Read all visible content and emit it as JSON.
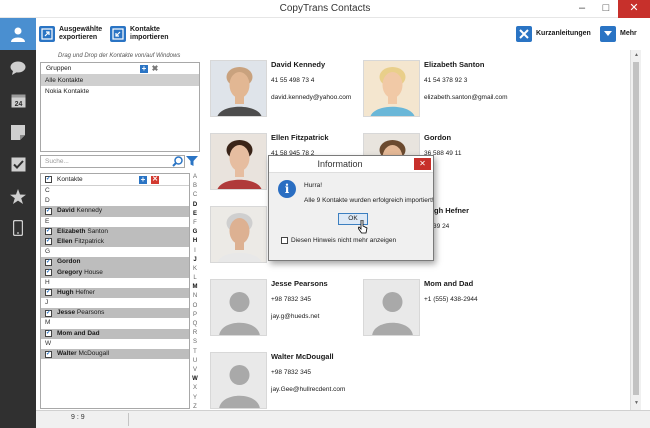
{
  "window": {
    "title": "CopyTrans Contacts"
  },
  "toolbar": {
    "export_label_1": "Ausgewählte",
    "export_label_2": "exportieren",
    "import_label_1": "Kontakte",
    "import_label_2": "importieren",
    "guides_label": "Kurzanleitungen",
    "more_label": "Mehr"
  },
  "hint": "Drag und Drop der Kontakte von/auf Windows",
  "groups": {
    "header": "Gruppen",
    "items": [
      "Alle Kontakte",
      "Nokia Kontakte"
    ]
  },
  "search": {
    "placeholder": "Suche..."
  },
  "contacts_list": {
    "header": "Kontakte",
    "rows": [
      {
        "letter": "C"
      },
      {
        "letter": "D"
      },
      {
        "first": "David",
        "last": "Kennedy"
      },
      {
        "letter": "E"
      },
      {
        "first": "Elizabeth",
        "last": "Santon"
      },
      {
        "first": "Ellen",
        "last": "Fitzpatrick"
      },
      {
        "letter": "G"
      },
      {
        "first": "Gordon",
        "last": ""
      },
      {
        "first": "Gregory",
        "last": "House"
      },
      {
        "letter": "H"
      },
      {
        "first": "Hugh",
        "last": "Hefner"
      },
      {
        "letter": "J"
      },
      {
        "first": "Jesse",
        "last": "Pearsons"
      },
      {
        "letter": "M"
      },
      {
        "first": "Mom and Dad",
        "last": ""
      },
      {
        "letter": "W"
      },
      {
        "first": "Walter",
        "last": "McDougall"
      }
    ]
  },
  "alphabet": [
    "A",
    "B",
    "C",
    "D",
    "E",
    "F",
    "G",
    "H",
    "I",
    "J",
    "K",
    "L",
    "M",
    "N",
    "O",
    "P",
    "Q",
    "R",
    "S",
    "T",
    "U",
    "V",
    "W",
    "X",
    "Y",
    "Z"
  ],
  "alphabet_active": [
    "D",
    "E",
    "G",
    "H",
    "J",
    "M",
    "W"
  ],
  "cards": [
    {
      "name": "David Kennedy",
      "phone": "41 55 498 73 4",
      "email": "david.kennedy@yahoo.com",
      "photo": "man-bald"
    },
    {
      "name": "Elizabeth Santon",
      "phone": "41 54 378 92 3",
      "email": "elizabeth.santon@gmail.com",
      "photo": "woman-blonde"
    },
    {
      "name": "Ellen Fitzpatrick",
      "phone": "41 58 945 78 2",
      "email": "",
      "photo": "woman-dark"
    },
    {
      "name": "Gordon",
      "phone": "36 588 49 11",
      "email": "",
      "photo": "man-young"
    },
    {
      "name": "",
      "phone": "",
      "email": "",
      "photo": "man-grey"
    },
    {
      "name": "Hugh Hefner",
      "phone": "57 39 24",
      "email": "",
      "photo": "none"
    },
    {
      "name": "Jesse Pearsons",
      "phone": "+98 7832 345",
      "email": "jay.g@hueds.net",
      "photo": "placeholder"
    },
    {
      "name": "Mom and Dad",
      "phone": "+1 (555) 438-2944",
      "email": "",
      "photo": "placeholder"
    },
    {
      "name": "Walter McDougall",
      "phone": "+98 7832 345",
      "email": "jay.Gee@hullrecdent.com",
      "photo": "placeholder"
    }
  ],
  "status": {
    "count": "9 : 9"
  },
  "dialog": {
    "title": "Information",
    "heading": "Hurra!",
    "message": "Alle 9 Kontakte wurden erfolgreich importiert!",
    "ok_label": "OK",
    "checkbox_label": "Diesen Hinweis nicht mehr anzeigen"
  },
  "icons": {
    "nav": [
      "contacts-icon",
      "messages-icon",
      "calendar-icon",
      "notes-icon",
      "tasks-icon",
      "favorites-icon",
      "phone-icon"
    ],
    "calendar_day": "24"
  },
  "colors": {
    "accent": "#4a8fd0",
    "sidebar": "#303030",
    "close": "#c7302b",
    "highlight_row": "#bdbdbd"
  }
}
